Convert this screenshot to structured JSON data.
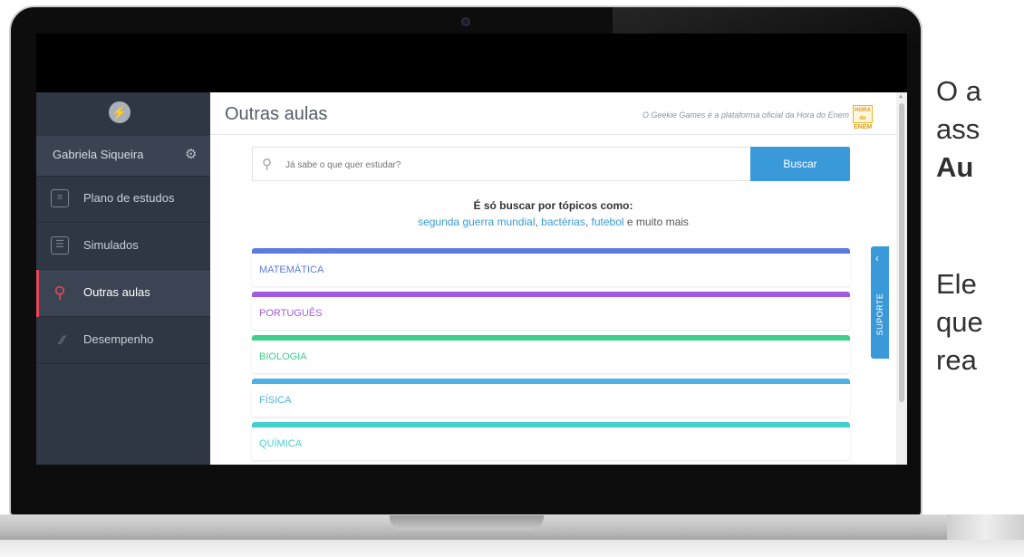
{
  "sidebar": {
    "user_name": "Gabriela Siqueira",
    "items": [
      {
        "label": "Plano de estudos"
      },
      {
        "label": "Simulados"
      },
      {
        "label": "Outras aulas"
      },
      {
        "label": "Desempenho"
      }
    ],
    "active_item": "Outras aulas"
  },
  "header": {
    "title": "Outras aulas",
    "note": "O Geekie Games é a plataforma oficial da Hora do Enem",
    "badge_top": "HORA do",
    "badge_bottom": "ENEM"
  },
  "search": {
    "placeholder": "Já sabe o que quer estudar?",
    "button_label": "Buscar"
  },
  "hints": {
    "title": "É só buscar por tópicos como:",
    "topic_1": "segunda guerra mundial",
    "sep_1": ", ",
    "topic_2": "bactérias",
    "sep_2": ", ",
    "topic_3": "futebol",
    "tail": " e muito mais"
  },
  "subjects": [
    {
      "label": "MATEMÁTICA",
      "color": "#5b7be0"
    },
    {
      "label": "PORTUGUÊS",
      "color": "#a25be0"
    },
    {
      "label": "BIOLOGIA",
      "color": "#3fcf8a"
    },
    {
      "label": "FÍSICA",
      "color": "#4fb0e4"
    },
    {
      "label": "QUÍMICA",
      "color": "#43d0cf"
    }
  ],
  "support": {
    "label": "SUPORTE"
  },
  "side_text": {
    "line1": "O a",
    "line2": "ass",
    "line3": "Au",
    "line4": "Ele",
    "line5": "que",
    "line6": "rea"
  },
  "colors": {
    "sidebar_bg": "#2f3744",
    "accent": "#3a9ad9",
    "active_marker": "#e8475a"
  },
  "icons": [
    "logo-icon",
    "gear-icon",
    "plan-icon",
    "list-icon",
    "search-icon",
    "chart-line-icon",
    "chevron-left-icon"
  ]
}
